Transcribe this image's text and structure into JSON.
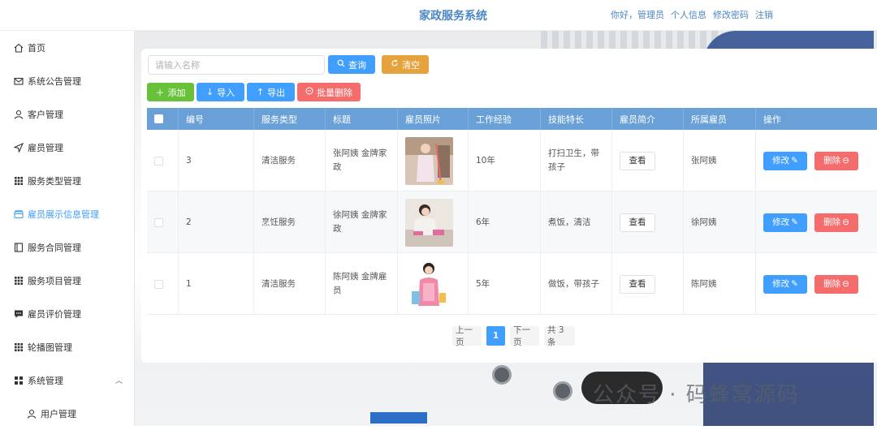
{
  "header": {
    "app_title": "家政服务系统",
    "greeting": "你好，管理员",
    "profile_link": "个人信息",
    "password_link": "修改密码",
    "logout_link": "注销"
  },
  "sidebar": {
    "items": [
      {
        "label": "首页",
        "icon": "home-icon"
      },
      {
        "label": "系统公告管理",
        "icon": "mail-icon"
      },
      {
        "label": "客户管理",
        "icon": "user-icon"
      },
      {
        "label": "雇员管理",
        "icon": "send-icon"
      },
      {
        "label": "服务类型管理",
        "icon": "grid-icon"
      },
      {
        "label": "雇员展示信息管理",
        "icon": "wallet-icon",
        "active": true
      },
      {
        "label": "服务合同管理",
        "icon": "notebook-icon"
      },
      {
        "label": "服务项目管理",
        "icon": "grid-icon"
      },
      {
        "label": "雇员评价管理",
        "icon": "chat-icon"
      },
      {
        "label": "轮播图管理",
        "icon": "grid-icon"
      },
      {
        "label": "系统管理",
        "icon": "menu-icon",
        "expanded": true
      },
      {
        "label": "用户管理",
        "icon": "user-icon",
        "sub": true
      }
    ]
  },
  "toolbar": {
    "search_placeholder": "请输入名称",
    "query_label": "查询",
    "clear_label": "清空",
    "add_label": "添加",
    "import_label": "导入",
    "export_label": "导出",
    "batch_delete_label": "批量删除"
  },
  "table": {
    "columns": [
      "编号",
      "服务类型",
      "标题",
      "雇员照片",
      "工作经验",
      "技能特长",
      "雇员简介",
      "所属雇员",
      "操作"
    ],
    "view_label": "查看",
    "edit_label": "修改",
    "delete_label": "删除",
    "rows": [
      {
        "id": "3",
        "service_type": "清洁服务",
        "title": "张阿姨 金牌家政",
        "experience": "10年",
        "skills": "打扫卫生，带孩子",
        "employee": "张阿姨"
      },
      {
        "id": "2",
        "service_type": "烹饪服务",
        "title": "徐阿姨 金牌家政",
        "experience": "6年",
        "skills": "煮饭，清洁",
        "employee": "徐阿姨"
      },
      {
        "id": "1",
        "service_type": "清洁服务",
        "title": "陈阿姨 金牌雇员",
        "experience": "5年",
        "skills": "做饭，带孩子",
        "employee": "陈阿姨"
      }
    ]
  },
  "pagination": {
    "prev_label": "上一页",
    "current_page": "1",
    "next_label": "下一页",
    "total_label": "共 3 条"
  },
  "watermark": "公众号 · 码蜂窝源码",
  "colors": {
    "primary": "#409eff",
    "header_blue": "#4a86c5",
    "table_header": "#6aa0d8",
    "danger": "#f56c6c",
    "warning": "#e6a23c",
    "success": "#67c23a"
  }
}
